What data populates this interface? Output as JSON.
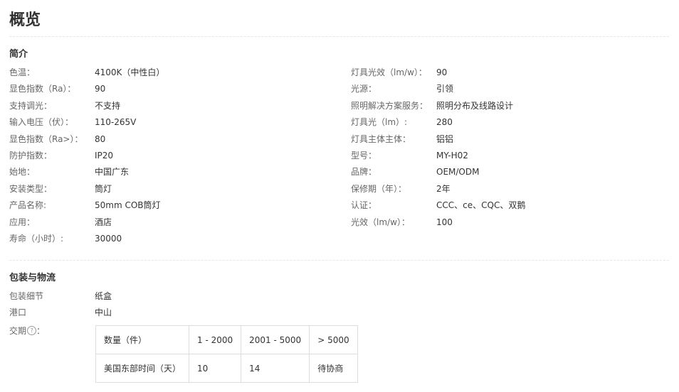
{
  "page": {
    "title": "概览"
  },
  "intro": {
    "heading": "简介",
    "left": [
      {
        "label": "色温：",
        "value": "4100K（中性白）"
      },
      {
        "label": "显色指数（Ra）：",
        "value": "90"
      },
      {
        "label": "支持调光：",
        "value": "不支持"
      },
      {
        "label": "输入电压（伏）：",
        "value": "110-265V"
      },
      {
        "label": "显色指数（Ra>）：",
        "value": "80"
      },
      {
        "label": "防护指数：",
        "value": "IP20"
      },
      {
        "label": "始地：",
        "value": "中国广东"
      },
      {
        "label": "安装类型：",
        "value": "筒灯"
      },
      {
        "label": "产品名称:",
        "value": "50mm COB筒灯"
      },
      {
        "label": "应用：",
        "value": "酒店"
      },
      {
        "label": "寿命（小时）:",
        "value": "30000"
      }
    ],
    "right": [
      {
        "label": "灯具光效（lm/w）：",
        "value": "90"
      },
      {
        "label": "光源：",
        "value": "引领"
      },
      {
        "label": "照明解决方案服务：",
        "value": "照明分布及线路设计"
      },
      {
        "label": "灯具光（lm）:",
        "value": "280"
      },
      {
        "label": "灯具主体主体：",
        "value": "铝铝"
      },
      {
        "label": "型号：",
        "value": "MY-H02"
      },
      {
        "label": "品牌：",
        "value": "OEM/ODM"
      },
      {
        "label": "保修期（年）：",
        "value": "2年"
      },
      {
        "label": "认证：",
        "value": "CCC、ce、CQC、双鹅"
      },
      {
        "label": "光效（lm/w）：",
        "value": "100"
      }
    ]
  },
  "packaging": {
    "heading": "包装与物流",
    "rows": [
      {
        "label": "包装细节",
        "value": "纸盒"
      },
      {
        "label": "港口",
        "value": "中山"
      }
    ],
    "lead_time_label": "交期",
    "lead_time_colon": "：",
    "help_icon": "question-circle-icon",
    "help_glyph": "?",
    "lead_table": {
      "row1": [
        "数量（件）",
        "1 - 2000",
        "2001 - 5000",
        "> 5000"
      ],
      "row2": [
        "美国东部时间（天）",
        "10",
        "14",
        "待协商"
      ]
    }
  }
}
